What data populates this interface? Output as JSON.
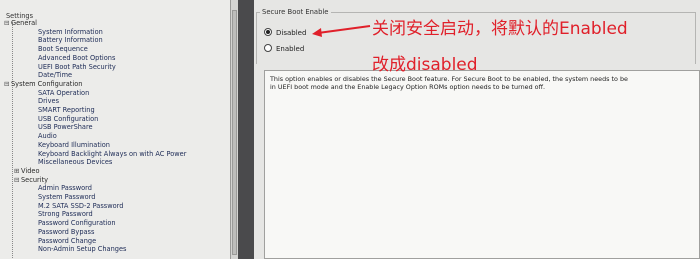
{
  "settings_tree": {
    "title": "Settings",
    "items": [
      {
        "label": "General",
        "toggle": "⊟",
        "level": 0
      },
      {
        "label": "System Information",
        "level": 2
      },
      {
        "label": "Battery Information",
        "level": 2
      },
      {
        "label": "Boot Sequence",
        "level": 2
      },
      {
        "label": "Advanced Boot Options",
        "level": 2
      },
      {
        "label": "UEFI Boot Path Security",
        "level": 2
      },
      {
        "label": "Date/Time",
        "level": 2
      },
      {
        "label": "System Configuration",
        "toggle": "⊟",
        "level": 0
      },
      {
        "label": "SATA Operation",
        "level": 2
      },
      {
        "label": "Drives",
        "level": 2
      },
      {
        "label": "SMART Reporting",
        "level": 2
      },
      {
        "label": "USB Configuration",
        "level": 2
      },
      {
        "label": "USB PowerShare",
        "level": 2
      },
      {
        "label": "Audio",
        "level": 2
      },
      {
        "label": "Keyboard Illumination",
        "level": 2
      },
      {
        "label": "Keyboard Backlight Always on with AC Power",
        "level": 2
      },
      {
        "label": "Miscellaneous Devices",
        "level": 2
      },
      {
        "label": "Video",
        "toggle": "⊞",
        "level": 1
      },
      {
        "label": "Security",
        "toggle": "⊟",
        "level": 1
      },
      {
        "label": "Admin Password",
        "level": 2
      },
      {
        "label": "System Password",
        "level": 2
      },
      {
        "label": "M.2 SATA SSD-2 Password",
        "level": 2
      },
      {
        "label": "Strong Password",
        "level": 2
      },
      {
        "label": "Password Configuration",
        "level": 2
      },
      {
        "label": "Password Bypass",
        "level": 2
      },
      {
        "label": "Password Change",
        "level": 2
      },
      {
        "label": "Non-Admin Setup Changes",
        "level": 2
      }
    ]
  },
  "secure_boot": {
    "section_title": "Secure Boot Enable",
    "options": [
      {
        "label": "Disabled",
        "selected": true
      },
      {
        "label": "Enabled",
        "selected": false
      }
    ],
    "description_line1": "This option enables or disables the Secure Boot feature. For Secure Boot to be enabled, the system needs to be",
    "description_line2": "in UEFI boot mode and the Enable Legacy Option ROMs option needs to be turned off."
  },
  "annotation": {
    "line1": "关闭安全启动，将默认的Enabled",
    "line2": "改成disabled",
    "color": "#e0202a"
  }
}
